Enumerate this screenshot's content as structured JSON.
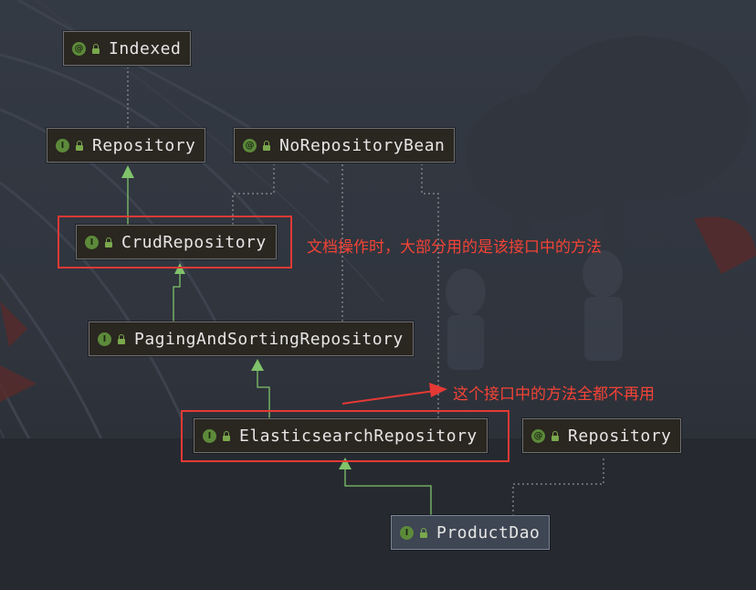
{
  "nodes": [
    {
      "id": "indexed",
      "label": "Indexed",
      "badge": "@",
      "kind": "annotation"
    },
    {
      "id": "repository",
      "label": "Repository",
      "badge": "I",
      "kind": "interface"
    },
    {
      "id": "norepositorybean",
      "label": "NoRepositoryBean",
      "badge": "@",
      "kind": "annotation"
    },
    {
      "id": "crudrepository",
      "label": "CrudRepository",
      "badge": "I",
      "kind": "interface"
    },
    {
      "id": "pagingandsortingrepository",
      "label": "PagingAndSortingRepository",
      "badge": "I",
      "kind": "interface"
    },
    {
      "id": "elasticsearchrepository",
      "label": "ElasticsearchRepository",
      "badge": "I",
      "kind": "interface"
    },
    {
      "id": "repository_annotation",
      "label": "Repository",
      "badge": "@",
      "kind": "annotation"
    },
    {
      "id": "productdao",
      "label": "ProductDao",
      "badge": "I",
      "kind": "interface"
    }
  ],
  "annotations": {
    "crud_note": "文档操作时，大部分用的是该接口中的方法",
    "elastic_note": "这个接口中的方法全都不再用"
  },
  "colors": {
    "highlight": "#e53935",
    "annotation_text": "#f44336",
    "inheritance_edge": "#7fc36a",
    "annotation_edge": "#a8a8a8"
  }
}
